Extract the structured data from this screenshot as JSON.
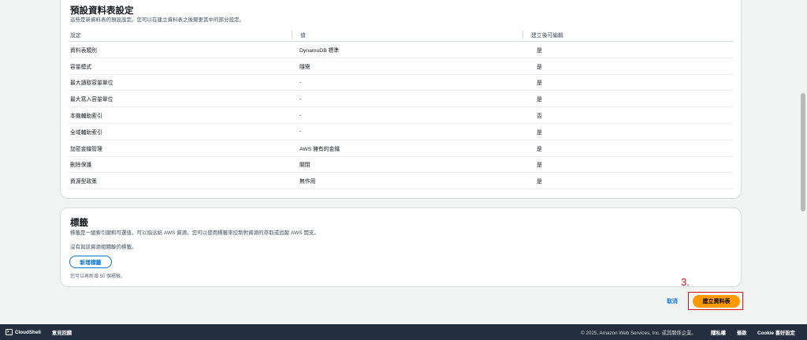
{
  "defaults": {
    "title": "預設資料表設定",
    "description": "這些是新資料表的預設設定。您可以在建立資料表之後變更其中的部分設定。",
    "headers": [
      "設定",
      "值",
      "建立後可編輯"
    ],
    "rows": [
      [
        "資料表類別",
        "DynamoDB 標準",
        "是"
      ],
      [
        "容量模式",
        "隨需",
        "是"
      ],
      [
        "最大讀取容量單位",
        "-",
        "是"
      ],
      [
        "最大寫入容量單位",
        "-",
        "是"
      ],
      [
        "本機輔助索引",
        "-",
        "否"
      ],
      [
        "全域輔助索引",
        "-",
        "是"
      ],
      [
        "加密金鑰管理",
        "AWS 擁有的金鑰",
        "是"
      ],
      [
        "刪除保護",
        "關閉",
        "是"
      ],
      [
        "資源型政策",
        "無作用",
        "是"
      ]
    ]
  },
  "tags": {
    "title": "標籤",
    "description": "標籤是一組索引鍵和可選值，可以指派給 AWS 資源。您可以使用標籤來控制對資源的存取或追蹤 AWS 開支。",
    "empty": "沒有與該資源相關聯的標籤。",
    "add_button": "新增標籤",
    "hint": "您可以再新增 50 個標籤。"
  },
  "actions": {
    "step": "3.",
    "cancel": "取消",
    "create": "建立資料表"
  },
  "footer": {
    "cloudshell": "CloudShell",
    "feedback": "意見回饋",
    "copyright": "© 2025, Amazon Web Services, Inc. 或其關係企業。",
    "privacy": "隱私權",
    "terms": "條款",
    "cookie": "Cookie 喜好設定"
  }
}
